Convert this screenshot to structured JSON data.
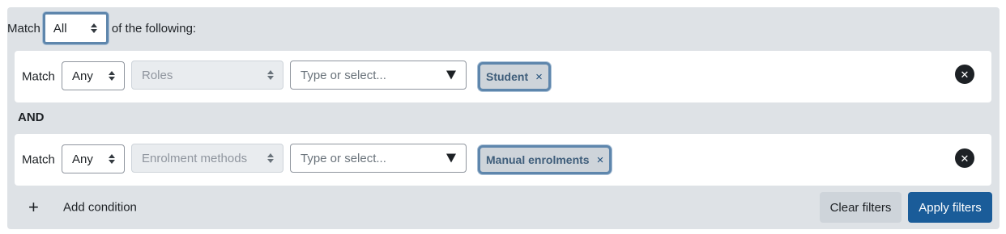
{
  "header": {
    "match_label": "Match",
    "match_value": "All",
    "suffix": "of the following:"
  },
  "conditions": [
    {
      "match_label": "Match",
      "match_value": "Any",
      "field": "Roles",
      "value_placeholder": "Type or select...",
      "tags": [
        {
          "label": "Student",
          "remove": "×"
        }
      ],
      "remove_icon": "close-icon"
    },
    {
      "match_label": "Match",
      "match_value": "Any",
      "field": "Enrolment methods",
      "value_placeholder": "Type or select...",
      "tags": [
        {
          "label": "Manual enrolments",
          "remove": "×"
        }
      ],
      "remove_icon": "close-icon"
    }
  ],
  "joiner": "AND",
  "footer": {
    "add_icon": "+",
    "add_condition": "Add condition",
    "clear_filters": "Clear filters",
    "apply_filters": "Apply filters"
  },
  "colors": {
    "panel_bg": "#dee2e6",
    "primary": "#1a5c99",
    "focus_ring": "#5e86ac",
    "tag_text": "#3e5d7a"
  }
}
